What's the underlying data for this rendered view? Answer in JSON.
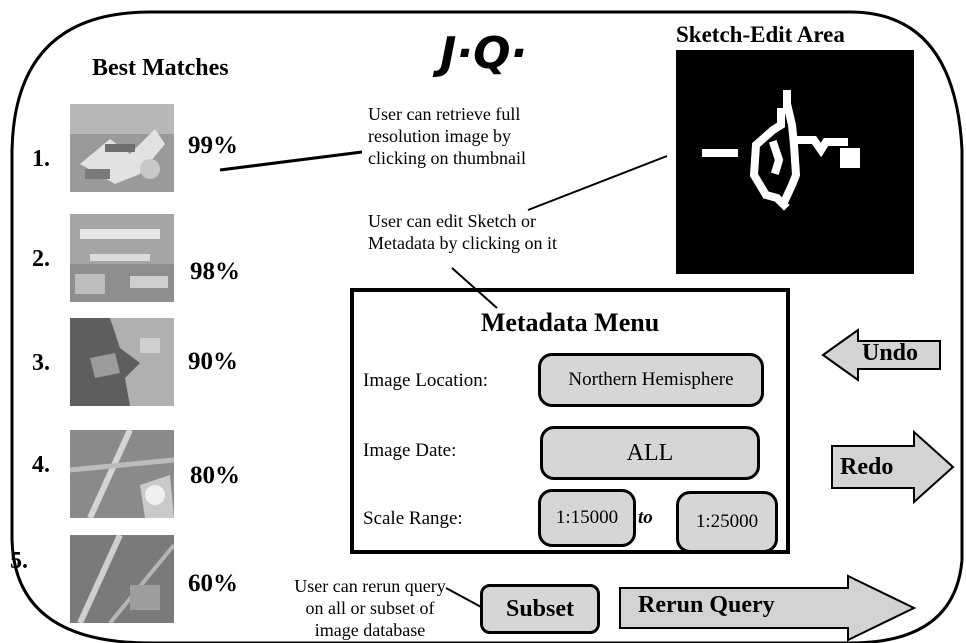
{
  "logo": "J·Q·",
  "best_matches": {
    "title": "Best Matches",
    "items": [
      {
        "rank": "1.",
        "score": "99%"
      },
      {
        "rank": "2.",
        "score": "98%"
      },
      {
        "rank": "3.",
        "score": "90%"
      },
      {
        "rank": "4.",
        "score": "80%"
      },
      {
        "rank": "5.",
        "score": "60%"
      }
    ]
  },
  "sketch": {
    "title": "Sketch-Edit Area"
  },
  "notes": {
    "retrieve": [
      "User can retrieve full",
      "resolution image by",
      "clicking on thumbnail"
    ],
    "edit": [
      "User can edit Sketch or",
      "Metadata by clicking on it"
    ],
    "rerun": [
      "User can rerun query",
      "on all or subset of",
      "image database"
    ]
  },
  "metadata_menu": {
    "title": "Metadata Menu",
    "location_label": "Image Location:",
    "location_value": "Northern Hemisphere",
    "date_label": "Image Date:",
    "date_value": "ALL",
    "scale_label": "Scale Range:",
    "scale_from": "1:15000",
    "scale_to_word": "to",
    "scale_to": "1:25000"
  },
  "buttons": {
    "undo": "Undo",
    "redo": "Redo",
    "subset": "Subset",
    "rerun": "Rerun Query"
  }
}
